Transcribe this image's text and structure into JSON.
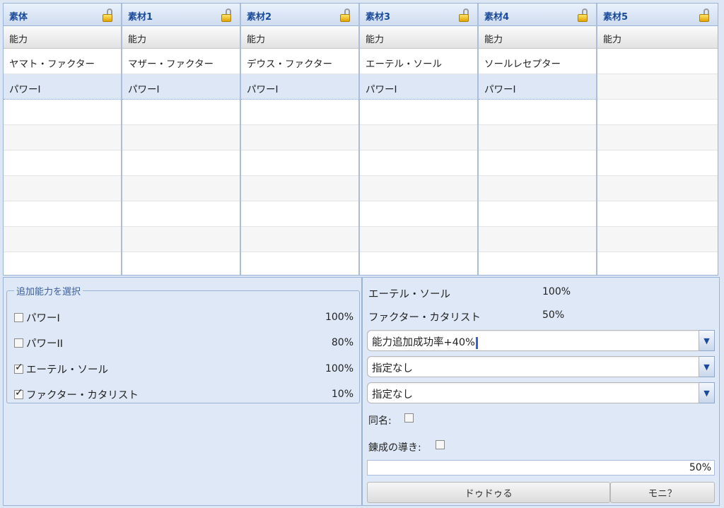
{
  "grid": {
    "columns": [
      {
        "header": "素体",
        "subheader": "能力",
        "rows": [
          "ヤマト・ファクター",
          "パワーI"
        ]
      },
      {
        "header": "素材1",
        "subheader": "能力",
        "rows": [
          "マザー・ファクター",
          "パワーI"
        ]
      },
      {
        "header": "素材2",
        "subheader": "能力",
        "rows": [
          "デウス・ファクター",
          "パワーI"
        ]
      },
      {
        "header": "素材3",
        "subheader": "能力",
        "rows": [
          "エーテル・ソール",
          "パワーI"
        ]
      },
      {
        "header": "素材4",
        "subheader": "能力",
        "rows": [
          "ソールレセプター",
          "パワーI"
        ]
      },
      {
        "header": "素材5",
        "subheader": "能力",
        "rows": [
          "",
          ""
        ]
      }
    ]
  },
  "add_ability": {
    "legend": "追加能力を選択",
    "options": [
      {
        "label": "パワーI",
        "percent": "100%",
        "checked": false
      },
      {
        "label": "パワーII",
        "percent": "80%",
        "checked": false
      },
      {
        "label": "エーテル・ソール",
        "percent": "100%",
        "checked": true
      },
      {
        "label": "ファクター・カタリスト",
        "percent": "10%",
        "checked": true
      }
    ]
  },
  "summary": {
    "items": [
      {
        "label": "エーテル・ソール",
        "value": "100%"
      },
      {
        "label": "ファクター・カタリスト",
        "value": "50%"
      }
    ],
    "selects": [
      "能力追加成功率+40%",
      "指定なし",
      "指定なし"
    ],
    "same_name_label": "同名:",
    "guide_label": "錬成の導き:",
    "rate_text": "50%",
    "rate_value": 0.5,
    "button_primary": "ドゥドゥる",
    "button_secondary": "モニ？"
  }
}
